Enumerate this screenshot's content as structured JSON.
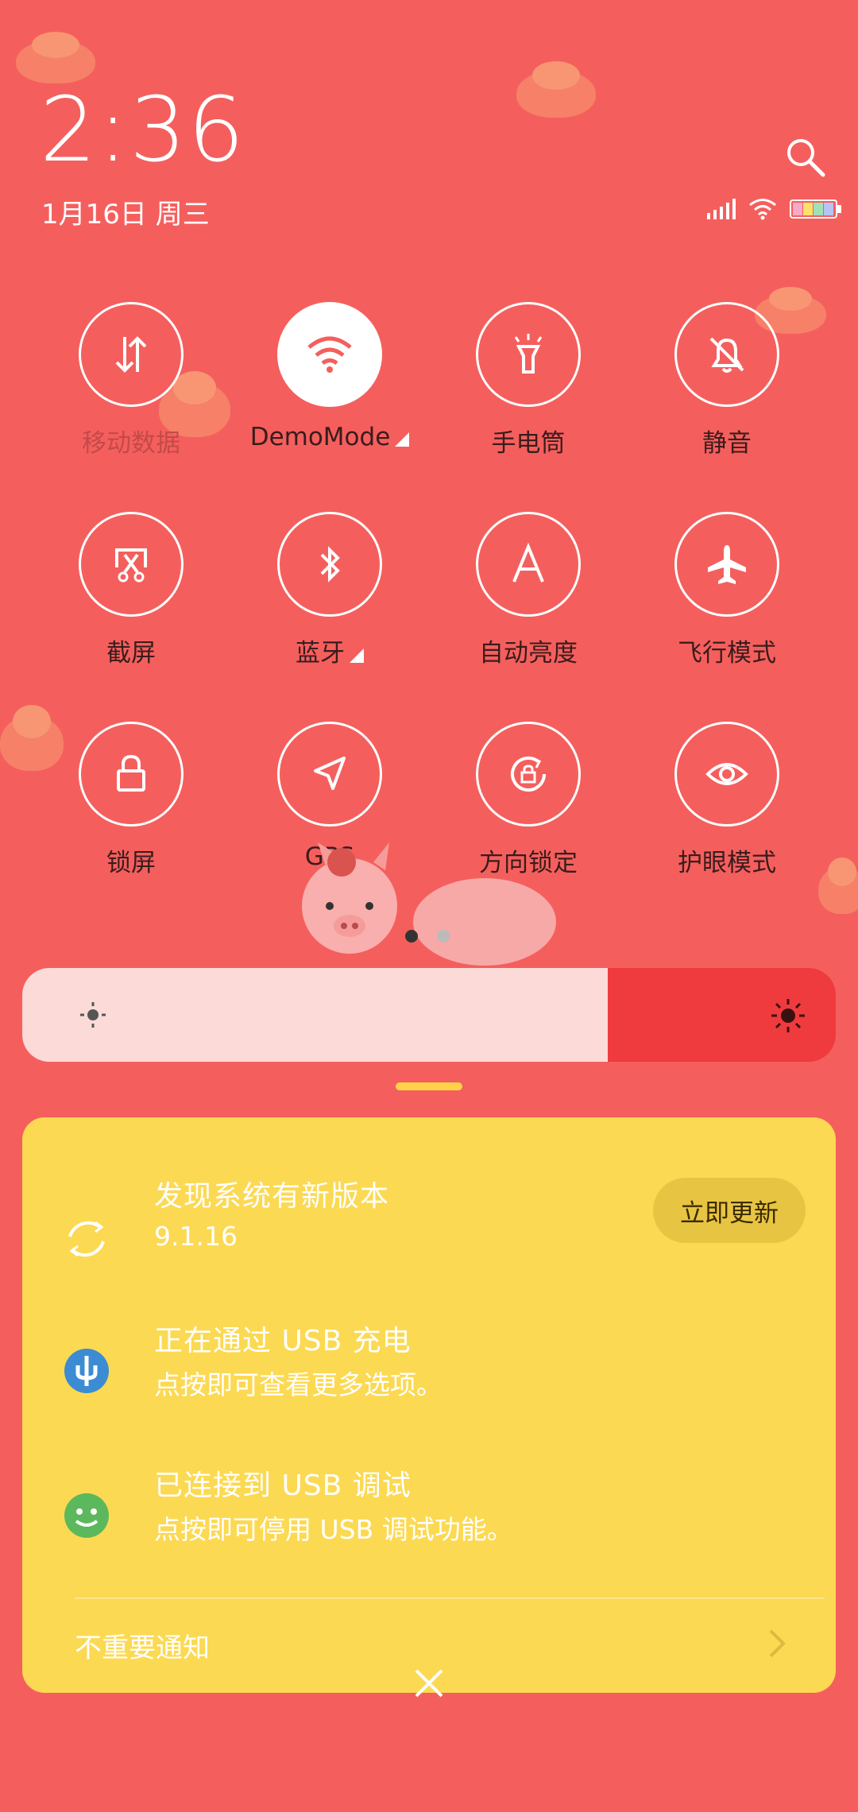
{
  "header": {
    "time": "2:36",
    "date": "1月16日 周三",
    "icons": [
      "search-icon",
      "signal-icon",
      "wifi-icon",
      "battery-icon"
    ]
  },
  "toggles": [
    {
      "label": "移动数据",
      "icon": "mobile-data-icon",
      "active": false,
      "dim": true
    },
    {
      "label": "DemoMode",
      "icon": "wifi-icon",
      "active": true,
      "expandable": true
    },
    {
      "label": "手电筒",
      "icon": "flashlight-icon",
      "active": false
    },
    {
      "label": "静音",
      "icon": "bell-off-icon",
      "active": false
    },
    {
      "label": "截屏",
      "icon": "screenshot-icon",
      "active": false
    },
    {
      "label": "蓝牙",
      "icon": "bluetooth-icon",
      "active": false,
      "expandable": true
    },
    {
      "label": "自动亮度",
      "icon": "auto-brightness-icon",
      "active": false
    },
    {
      "label": "飞行模式",
      "icon": "airplane-icon",
      "active": false
    },
    {
      "label": "锁屏",
      "icon": "lock-icon",
      "active": false
    },
    {
      "label": "GPS",
      "icon": "location-arrow-icon",
      "active": false
    },
    {
      "label": "方向锁定",
      "icon": "rotation-lock-icon",
      "active": false
    },
    {
      "label": "护眼模式",
      "icon": "eye-icon",
      "active": false
    }
  ],
  "pager": {
    "current": 1,
    "total": 2
  },
  "brightness": {
    "level": 0.72
  },
  "notifications": [
    {
      "title": "发现系统有新版本",
      "subtitle": "9.1.16",
      "action": "立即更新",
      "icon": "system-update-icon"
    },
    {
      "title": "正在通过 USB 充电",
      "subtitle": "点按即可查看更多选项。",
      "icon": "usb-icon"
    },
    {
      "title": "已连接到 USB 调试",
      "subtitle": "点按即可停用 USB 调试功能。",
      "icon": "android-icon"
    }
  ],
  "unimportant": {
    "label": "不重要通知"
  },
  "colors": {
    "background": "#F45F5D",
    "panel": "#FCD952",
    "brightness_track": "#EF3B3D",
    "brightness_fill": "#FBDAD8"
  }
}
